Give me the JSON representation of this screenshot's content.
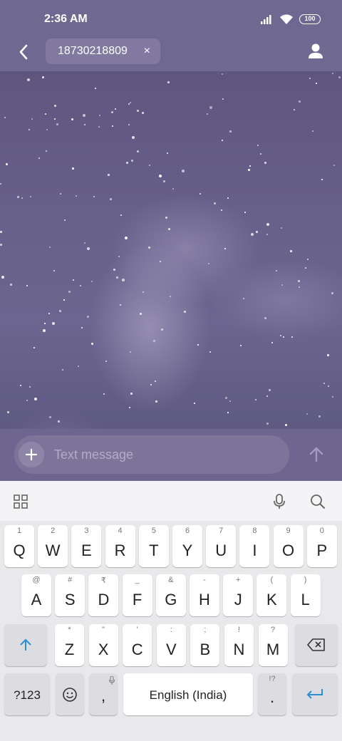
{
  "status_bar": {
    "time": "2:36 AM",
    "battery": "100"
  },
  "header": {
    "recipient": "18730218809",
    "chip_close": "×"
  },
  "compose": {
    "placeholder": "Text message"
  },
  "keyboard": {
    "row1": [
      {
        "label": "Q",
        "hint": "1"
      },
      {
        "label": "W",
        "hint": "2"
      },
      {
        "label": "E",
        "hint": "3"
      },
      {
        "label": "R",
        "hint": "4"
      },
      {
        "label": "T",
        "hint": "5"
      },
      {
        "label": "Y",
        "hint": "6"
      },
      {
        "label": "U",
        "hint": "7"
      },
      {
        "label": "I",
        "hint": "8"
      },
      {
        "label": "O",
        "hint": "9"
      },
      {
        "label": "P",
        "hint": "0"
      }
    ],
    "row2": [
      {
        "label": "A",
        "hint": "@"
      },
      {
        "label": "S",
        "hint": "#"
      },
      {
        "label": "D",
        "hint": "₹"
      },
      {
        "label": "F",
        "hint": "_"
      },
      {
        "label": "G",
        "hint": "&"
      },
      {
        "label": "H",
        "hint": "-"
      },
      {
        "label": "J",
        "hint": "+"
      },
      {
        "label": "K",
        "hint": "("
      },
      {
        "label": "L",
        "hint": ")"
      }
    ],
    "row3": [
      {
        "label": "Z",
        "hint": "*"
      },
      {
        "label": "X",
        "hint": "\""
      },
      {
        "label": "C",
        "hint": "'"
      },
      {
        "label": "V",
        "hint": ":"
      },
      {
        "label": "B",
        "hint": ";"
      },
      {
        "label": "N",
        "hint": "!"
      },
      {
        "label": "M",
        "hint": "?"
      }
    ],
    "symbols_label": "?123",
    "comma_label": ",",
    "space_label": "English (India)",
    "period_label": ".",
    "period_hint": "!?"
  }
}
